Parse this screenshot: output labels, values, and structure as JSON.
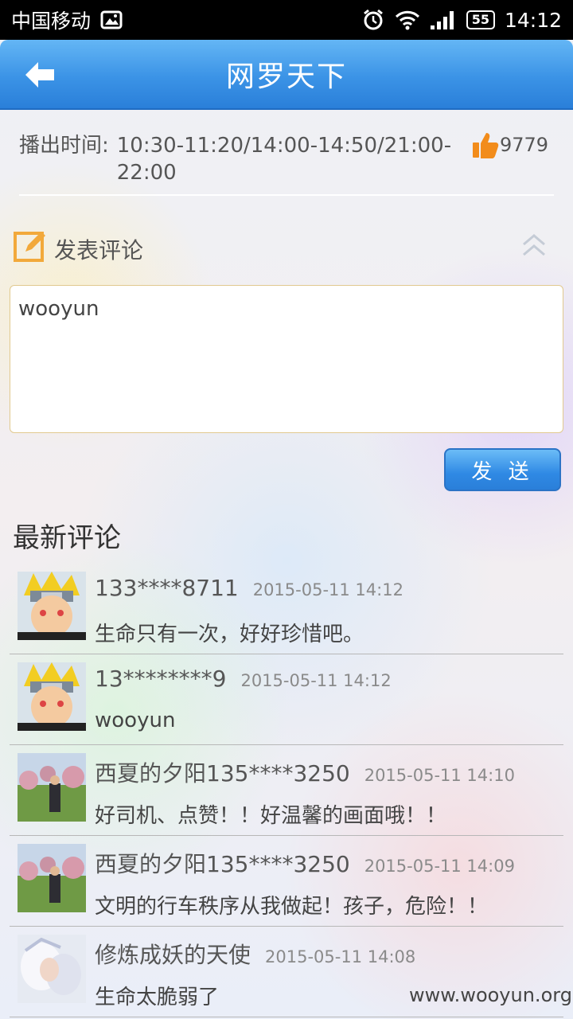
{
  "status_bar": {
    "carrier": "中国移动",
    "battery": "55",
    "time": "14:12"
  },
  "header": {
    "title": "网罗天下"
  },
  "program": {
    "airtime_label": "播出时间:",
    "airtime_value": "10:30-11:20/14:00-14:50/21:00-22:00",
    "likes": "9779"
  },
  "compose": {
    "heading": "发表评论",
    "input_value": "wooyun",
    "send_label": "发 送"
  },
  "latest": {
    "heading": "最新评论",
    "comments": [
      {
        "user": "133****8711",
        "time": "2015-05-11 14:12",
        "text": "生命只有一次，好好珍惜吧。",
        "avatar": "cartoon-ninja"
      },
      {
        "user": "13********9",
        "time": "2015-05-11 14:12",
        "text": "wooyun",
        "avatar": "cartoon-ninja"
      },
      {
        "user": "西夏的夕阳135****3250",
        "time": "2015-05-11 14:10",
        "text": "好司机、点赞！！好温馨的画面哦！！",
        "avatar": "photo-man-orchard"
      },
      {
        "user": "西夏的夕阳135****3250",
        "time": "2015-05-11 14:09",
        "text": "文明的行车秩序从我做起！孩子，危险！！",
        "avatar": "photo-man-orchard"
      },
      {
        "user": "修炼成妖的天使",
        "time": "2015-05-11 14:08",
        "text": "生命太脆弱了",
        "avatar": "fantasy-white-figure"
      }
    ]
  },
  "watermark": "www.wooyun.org",
  "colors": {
    "header_blue": "#3b93e6",
    "like_orange": "#f28c1b",
    "edit_icon_orange": "#f2a93b"
  }
}
